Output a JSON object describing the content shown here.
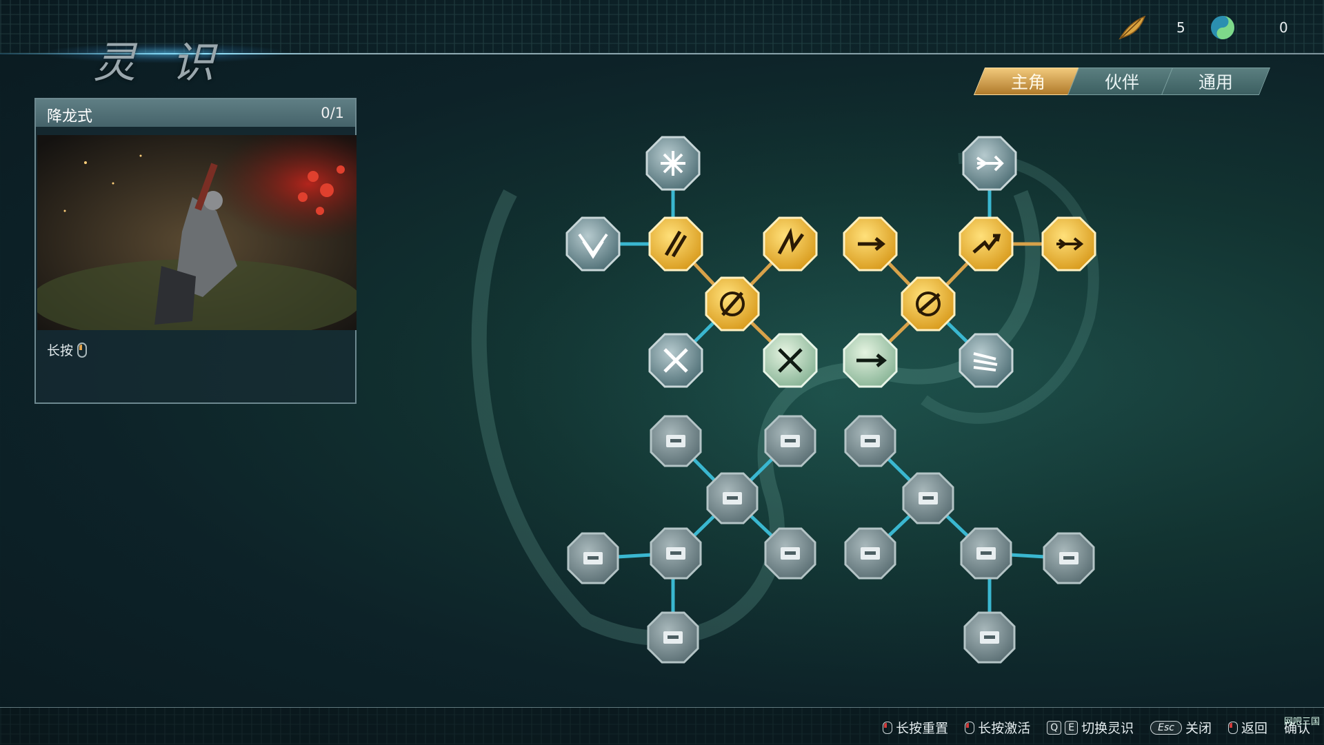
{
  "header": {
    "title": "灵 识"
  },
  "currencies": [
    {
      "icon": "feather-icon",
      "count": "5"
    },
    {
      "icon": "yin-yang-orb-icon",
      "count": "0"
    }
  ],
  "tabs": [
    {
      "label": "主角",
      "active": true
    },
    {
      "label": "伙伴",
      "active": false
    },
    {
      "label": "通用",
      "active": false
    }
  ],
  "detail": {
    "name": "降龙式",
    "progress": "0/1",
    "hold_label": "长按"
  },
  "footer": {
    "hints": [
      {
        "icon": "mouse-icon",
        "label": "长按重置"
      },
      {
        "icon": "mouse-icon",
        "label": "长按激活"
      },
      {
        "keys": [
          "Q",
          "E"
        ],
        "label": "切换灵识"
      },
      {
        "keys": [
          "Esc"
        ],
        "label": "关闭"
      },
      {
        "icon": "mouse-icon",
        "label": "返回"
      },
      {
        "label": "确认"
      }
    ],
    "watermark": "网吧三国"
  },
  "colors": {
    "gold": "#e8b33a",
    "teal_line": "#3ab7d0",
    "gold_line": "#d8a24a",
    "locked": "#8a9ea2",
    "cleared": "#c6e2c9"
  }
}
